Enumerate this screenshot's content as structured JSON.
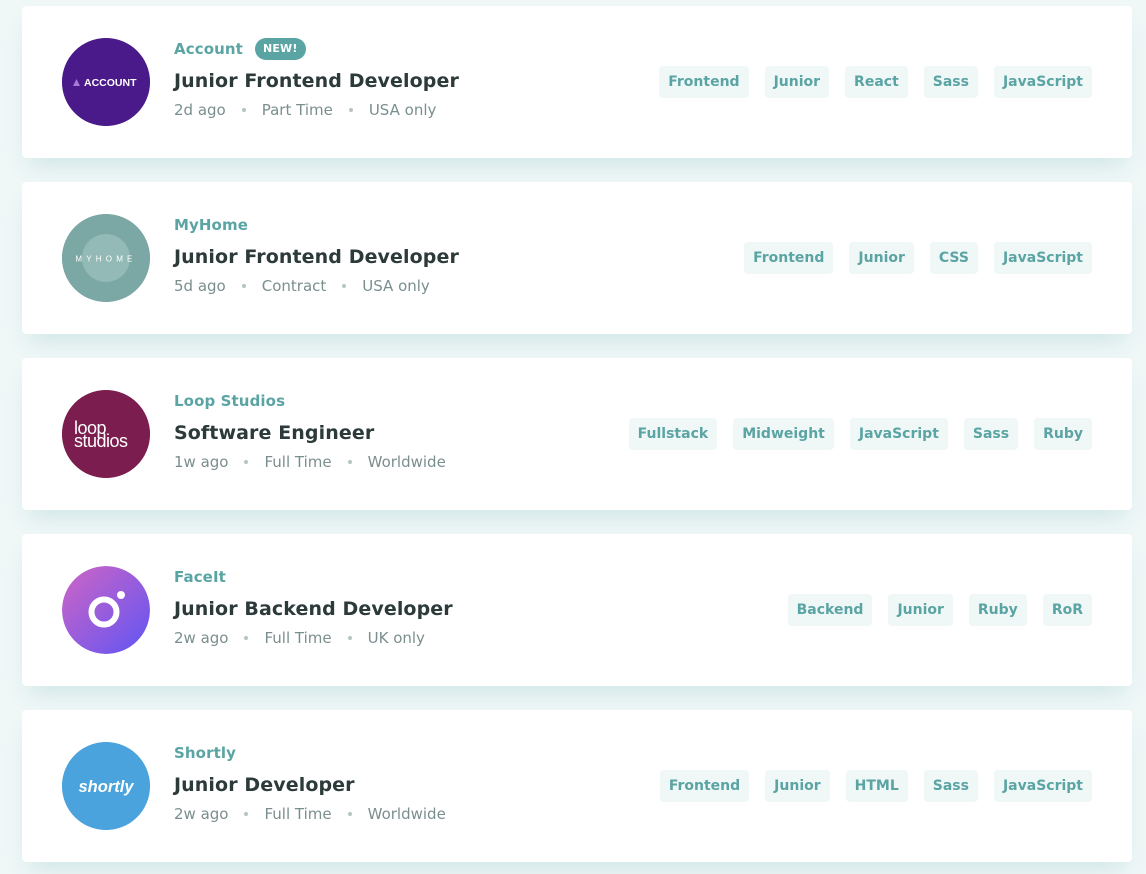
{
  "jobs": [
    {
      "company": "Account",
      "badge": "NEW!",
      "logo_text": "ACCOUNT",
      "logo_color": "#4a1a8a",
      "position": "Junior Frontend Developer",
      "posted": "2d ago",
      "contract": "Part Time",
      "location": "USA only",
      "tags": [
        "Frontend",
        "Junior",
        "React",
        "Sass",
        "JavaScript"
      ]
    },
    {
      "company": "MyHome",
      "logo_text": "MYHOME",
      "logo_color": "#7ba7a4",
      "position": "Junior Frontend Developer",
      "posted": "5d ago",
      "contract": "Contract",
      "location": "USA only",
      "tags": [
        "Frontend",
        "Junior",
        "CSS",
        "JavaScript"
      ]
    },
    {
      "company": "Loop Studios",
      "logo_text_line1": "loop",
      "logo_text_line2": "studios",
      "logo_color": "#7c1d4f",
      "position": "Software Engineer",
      "posted": "1w ago",
      "contract": "Full Time",
      "location": "Worldwide",
      "tags": [
        "Fullstack",
        "Midweight",
        "JavaScript",
        "Sass",
        "Ruby"
      ]
    },
    {
      "company": "FaceIt",
      "logo_color_start": "#c15ec9",
      "logo_color_end": "#6b55f0",
      "position": "Junior Backend Developer",
      "posted": "2w ago",
      "contract": "Full Time",
      "location": "UK only",
      "tags": [
        "Backend",
        "Junior",
        "Ruby",
        "RoR"
      ]
    },
    {
      "company": "Shortly",
      "logo_text": "shortly",
      "logo_color": "#4aa3dc",
      "position": "Junior Developer",
      "posted": "2w ago",
      "contract": "Full Time",
      "location": "Worldwide",
      "tags": [
        "Frontend",
        "Junior",
        "HTML",
        "Sass",
        "JavaScript"
      ]
    }
  ],
  "colors": {
    "accent": "#5ba4a4",
    "background": "#eff7f7",
    "title": "#2c3a3a",
    "meta": "#7b8e8e"
  }
}
